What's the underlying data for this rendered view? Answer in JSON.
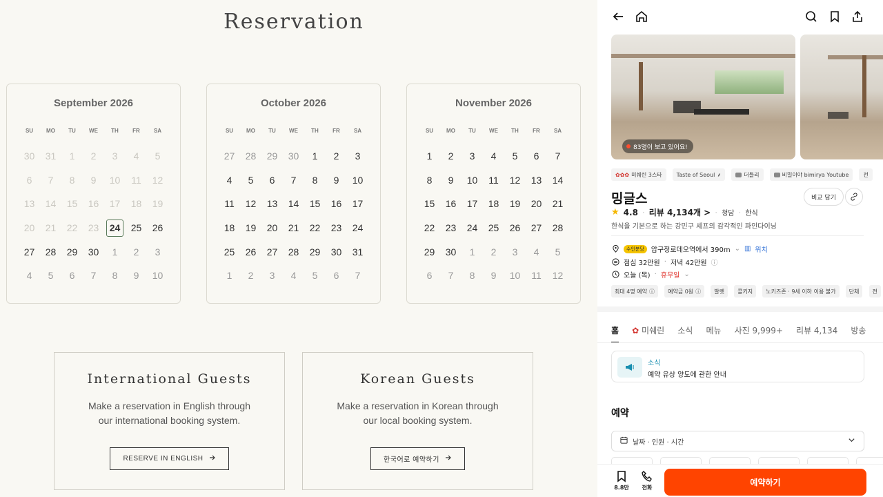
{
  "site": {
    "title": "Reservation",
    "weekdays": [
      "SU",
      "MO",
      "TU",
      "WE",
      "TH",
      "FR",
      "SA"
    ],
    "calendars": [
      {
        "month": "September 2026",
        "weeks": [
          [
            [
              "30",
              "muted"
            ],
            [
              "31",
              "muted"
            ],
            [
              "1",
              "muted"
            ],
            [
              "2",
              "muted"
            ],
            [
              "3",
              "muted"
            ],
            [
              "4",
              "muted"
            ],
            [
              "5",
              "muted"
            ]
          ],
          [
            [
              "6",
              "muted"
            ],
            [
              "7",
              "muted"
            ],
            [
              "8",
              "muted"
            ],
            [
              "9",
              "muted"
            ],
            [
              "10",
              "muted"
            ],
            [
              "11",
              "muted"
            ],
            [
              "12",
              "muted"
            ]
          ],
          [
            [
              "13",
              "muted"
            ],
            [
              "14",
              "muted"
            ],
            [
              "15",
              "muted"
            ],
            [
              "16",
              "muted"
            ],
            [
              "17",
              "muted"
            ],
            [
              "18",
              "muted"
            ],
            [
              "19",
              "muted"
            ]
          ],
          [
            [
              "20",
              "muted"
            ],
            [
              "21",
              "muted"
            ],
            [
              "22",
              "muted"
            ],
            [
              "23",
              "muted"
            ],
            [
              "24",
              "today"
            ],
            [
              "25",
              ""
            ],
            [
              "26",
              ""
            ]
          ],
          [
            [
              "27",
              ""
            ],
            [
              "28",
              ""
            ],
            [
              "29",
              ""
            ],
            [
              "30",
              ""
            ],
            [
              "1",
              "gray"
            ],
            [
              "2",
              "gray"
            ],
            [
              "3",
              "gray"
            ]
          ],
          [
            [
              "4",
              "gray"
            ],
            [
              "5",
              "gray"
            ],
            [
              "6",
              "gray"
            ],
            [
              "7",
              "gray"
            ],
            [
              "8",
              "gray"
            ],
            [
              "9",
              "gray"
            ],
            [
              "10",
              "gray"
            ]
          ]
        ]
      },
      {
        "month": "October 2026",
        "weeks": [
          [
            [
              "27",
              "gray"
            ],
            [
              "28",
              "gray"
            ],
            [
              "29",
              "gray"
            ],
            [
              "30",
              "gray"
            ],
            [
              "1",
              ""
            ],
            [
              "2",
              ""
            ],
            [
              "3",
              ""
            ]
          ],
          [
            [
              "4",
              ""
            ],
            [
              "5",
              ""
            ],
            [
              "6",
              ""
            ],
            [
              "7",
              ""
            ],
            [
              "8",
              ""
            ],
            [
              "9",
              ""
            ],
            [
              "10",
              ""
            ]
          ],
          [
            [
              "11",
              ""
            ],
            [
              "12",
              ""
            ],
            [
              "13",
              ""
            ],
            [
              "14",
              ""
            ],
            [
              "15",
              ""
            ],
            [
              "16",
              ""
            ],
            [
              "17",
              ""
            ]
          ],
          [
            [
              "18",
              ""
            ],
            [
              "19",
              ""
            ],
            [
              "20",
              ""
            ],
            [
              "21",
              ""
            ],
            [
              "22",
              ""
            ],
            [
              "23",
              ""
            ],
            [
              "24",
              ""
            ]
          ],
          [
            [
              "25",
              ""
            ],
            [
              "26",
              ""
            ],
            [
              "27",
              ""
            ],
            [
              "28",
              ""
            ],
            [
              "29",
              ""
            ],
            [
              "30",
              ""
            ],
            [
              "31",
              ""
            ]
          ],
          [
            [
              "1",
              "gray"
            ],
            [
              "2",
              "gray"
            ],
            [
              "3",
              "gray"
            ],
            [
              "4",
              "gray"
            ],
            [
              "5",
              "gray"
            ],
            [
              "6",
              "gray"
            ],
            [
              "7",
              "gray"
            ]
          ]
        ]
      },
      {
        "month": "November 2026",
        "weeks": [
          [
            [
              "1",
              ""
            ],
            [
              "2",
              ""
            ],
            [
              "3",
              ""
            ],
            [
              "4",
              ""
            ],
            [
              "5",
              ""
            ],
            [
              "6",
              ""
            ],
            [
              "7",
              ""
            ]
          ],
          [
            [
              "8",
              ""
            ],
            [
              "9",
              ""
            ],
            [
              "10",
              ""
            ],
            [
              "11",
              ""
            ],
            [
              "12",
              ""
            ],
            [
              "13",
              ""
            ],
            [
              "14",
              ""
            ]
          ],
          [
            [
              "15",
              ""
            ],
            [
              "16",
              ""
            ],
            [
              "17",
              ""
            ],
            [
              "18",
              ""
            ],
            [
              "19",
              ""
            ],
            [
              "20",
              ""
            ],
            [
              "21",
              ""
            ]
          ],
          [
            [
              "22",
              ""
            ],
            [
              "23",
              ""
            ],
            [
              "24",
              ""
            ],
            [
              "25",
              ""
            ],
            [
              "26",
              ""
            ],
            [
              "27",
              ""
            ],
            [
              "28",
              ""
            ]
          ],
          [
            [
              "29",
              ""
            ],
            [
              "30",
              ""
            ],
            [
              "1",
              "gray"
            ],
            [
              "2",
              "gray"
            ],
            [
              "3",
              "gray"
            ],
            [
              "4",
              "gray"
            ],
            [
              "5",
              "gray"
            ]
          ],
          [
            [
              "6",
              "gray"
            ],
            [
              "7",
              "gray"
            ],
            [
              "8",
              "gray"
            ],
            [
              "9",
              "gray"
            ],
            [
              "10",
              "gray"
            ],
            [
              "11",
              "gray"
            ],
            [
              "12",
              "gray"
            ]
          ]
        ]
      }
    ],
    "international": {
      "title": "International Guests",
      "text": "Make a reservation in English through our international booking system.",
      "button": "RESERVE IN ENGLISH"
    },
    "korean": {
      "title": "Korean Guests",
      "text": "Make a reservation in Korean through our local booking system.",
      "button": "한국어로 예약하기"
    }
  },
  "app": {
    "viewers": "83명이 보고 있어요!",
    "badges": [
      "미쉐린 3스타",
      "Taste of Seoul",
      "더들리",
      "비밀이야 bimirya Youtube",
      "전"
    ],
    "name": "밍글스",
    "compare": "비교 담기",
    "rating": "4.8",
    "reviews": "리뷰 4,134개 >",
    "area": "청담",
    "cuisine": "한식",
    "description": "한식을 기본으로 하는 강민구 셰프의 감각적인 파인다이닝",
    "metro": "수인분당",
    "location": "압구정로데오역에서 390m",
    "map_link": "위치",
    "price_lunch": "점심 32만원",
    "price_dinner": "저녁 42만원",
    "today_label": "오늘 (목)",
    "today_status": "휴무일",
    "chips": [
      "최대 4명 예약",
      "예약금 0원",
      "발렛",
      "콜키지",
      "노키즈존 · 9세 이하 이용 불가",
      "단체",
      "전"
    ],
    "tabs": [
      "홈",
      "미쉐린",
      "소식",
      "메뉴",
      "사진 9,999+",
      "리뷰 4,134",
      "방송"
    ],
    "news_title": "소식",
    "news_body": "예약 유상 양도에 관한 안내",
    "reserve_section": "예약",
    "select_label": "날짜 · 인원 · 시간",
    "save_count": "8.8만",
    "call_label": "전화",
    "reserve_button": "예약하기",
    "colors": {
      "accent": "#ff4400",
      "michelin": "#d3342f",
      "link": "#2f6fd6"
    }
  }
}
